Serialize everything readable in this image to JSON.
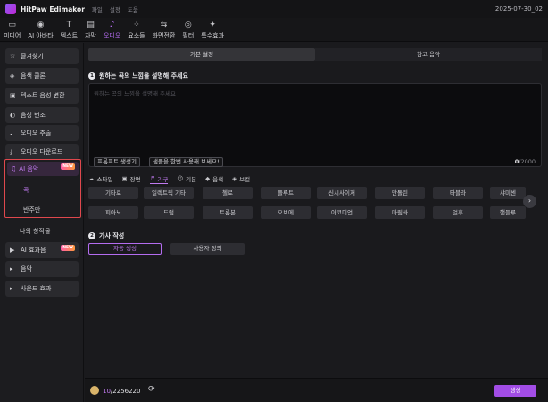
{
  "titlebar": {
    "app_name": "HitPaw Edimakor",
    "menus": [
      "파일",
      "설정",
      "도움"
    ],
    "date": "2025-07-30_02"
  },
  "toolbar": [
    {
      "label": "미디어",
      "icon": "media-icon"
    },
    {
      "label": "AI 아바타",
      "icon": "ai-avatar-icon"
    },
    {
      "label": "텍스트",
      "icon": "text-icon"
    },
    {
      "label": "자막",
      "icon": "subtitle-icon"
    },
    {
      "label": "오디오",
      "icon": "audio-icon",
      "active": true
    },
    {
      "label": "요소들",
      "icon": "elements-icon"
    },
    {
      "label": "화면전환",
      "icon": "transition-icon"
    },
    {
      "label": "필터",
      "icon": "filter-icon"
    },
    {
      "label": "특수효과",
      "icon": "effects-icon"
    }
  ],
  "sidebar": {
    "items": [
      {
        "label": "즐겨찾기",
        "icon": "star-icon"
      },
      {
        "label": "음색 클론",
        "icon": "voice-clone-icon"
      },
      {
        "label": "텍스트 음성 변환",
        "icon": "tts-icon"
      },
      {
        "label": "음성 변조",
        "icon": "voice-change-icon"
      },
      {
        "label": "오디오 추출",
        "icon": "mic-icon"
      },
      {
        "label": "오디오 다운로드",
        "icon": "download-icon"
      }
    ],
    "ai_music": {
      "label": "AI 음악",
      "badge": "NEW",
      "subitems": [
        "곡",
        "반주만"
      ]
    },
    "my_works": "나의 창작물",
    "ai_sfx": {
      "label": "AI 효과음",
      "badge": "NEW"
    },
    "music": "음악",
    "sound_effects": "사운드 효과"
  },
  "main": {
    "tabs": [
      "기본 설정",
      "참고 음악"
    ],
    "step1_title": "원하는 곡의 느낌을 설명해 주세요",
    "step1_num": "1",
    "textarea_placeholder": "원하는 곡의 느낌을 설명해 주세요",
    "prompt_button": "프롬프트 생성기",
    "sample_button": "샘플을 한번 사용해 보세요!",
    "counter_value": "0",
    "counter_max": "/2000",
    "categories": [
      {
        "label": "스타일",
        "icon": "style-icon"
      },
      {
        "label": "장면",
        "icon": "scene-icon"
      },
      {
        "label": "기구",
        "icon": "instrument-icon",
        "active": true
      },
      {
        "label": "기분",
        "icon": "mood-icon"
      },
      {
        "label": "음색",
        "icon": "timbre-icon"
      },
      {
        "label": "보컬",
        "icon": "vocal-icon"
      }
    ],
    "instruments_row1": [
      "기타로",
      "일렉트릭 기타",
      "첼로",
      "플루트",
      "신시사이저",
      "만돌린",
      "타블라",
      "샤미센"
    ],
    "instruments_row2": [
      "피아노",
      "드럼",
      "트롬본",
      "오보에",
      "아코디언",
      "마림바",
      "얼후",
      "핸들루"
    ],
    "step2_title": "가사 작성",
    "step2_num": "2",
    "lyric_modes": [
      "자동 생성",
      "사용자 정의"
    ],
    "credits_used": "10",
    "credits_total": "/2256220",
    "generate_button": "생성"
  }
}
